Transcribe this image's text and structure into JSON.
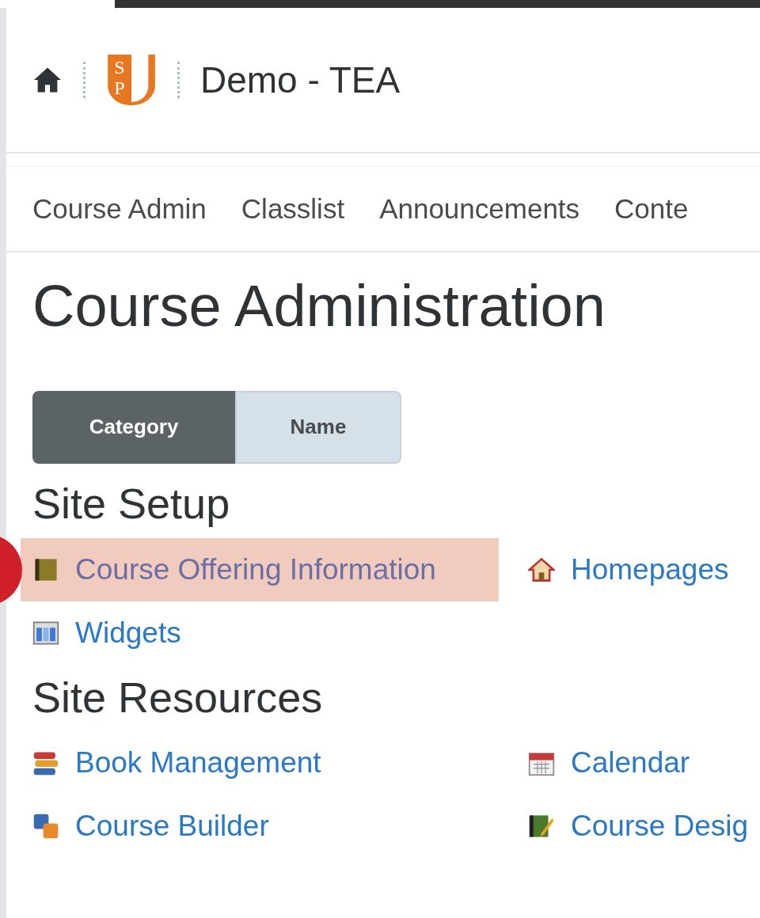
{
  "header": {
    "logo": {
      "letters": [
        "S",
        "P"
      ]
    },
    "title": "Demo - TEA"
  },
  "nav": [
    "Course Admin",
    "Classlist",
    "Announcements",
    "Conte"
  ],
  "page_title": "Course Administration",
  "view_toggle": [
    {
      "label": "Category",
      "selected": true
    },
    {
      "label": "Name",
      "selected": false
    }
  ],
  "sections": [
    {
      "title": "Site Setup",
      "items": [
        {
          "label": "Course Offering Information",
          "kind": "book",
          "highlighted": true
        },
        {
          "label": "Homepages",
          "kind": "house",
          "highlighted": false
        },
        {
          "label": "Widgets",
          "kind": "widgets",
          "highlighted": false
        }
      ]
    },
    {
      "title": "Site Resources",
      "items": [
        {
          "label": "Book Management",
          "kind": "books",
          "highlighted": false
        },
        {
          "label": "Calendar",
          "kind": "calendar",
          "highlighted": false
        },
        {
          "label": "Course Builder",
          "kind": "builder",
          "highlighted": false
        },
        {
          "label": "Course Desig",
          "kind": "designer",
          "highlighted": false
        }
      ]
    }
  ]
}
